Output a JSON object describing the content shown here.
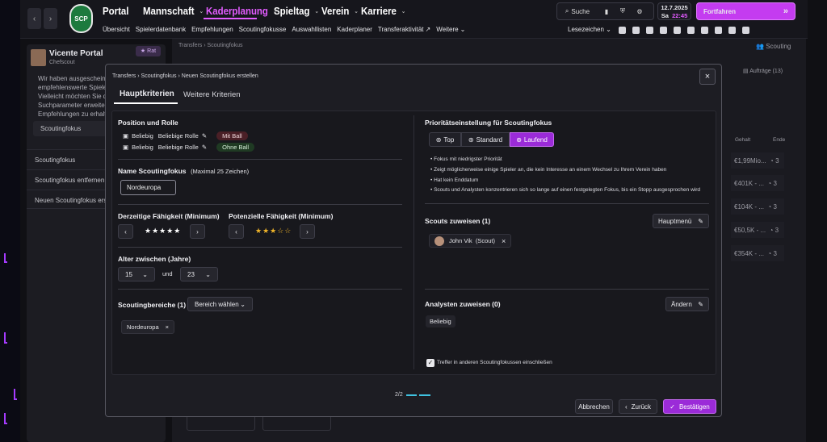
{
  "app": {
    "menu": [
      "Portal",
      "Mannschaft",
      "Kaderplanung",
      "Spieltag",
      "Verein",
      "Karriere"
    ],
    "subnav": [
      "Übersicht",
      "Spielerdatenbank",
      "Empfehlungen",
      "Scoutingfokusse",
      "Auswahllisten",
      "Kaderplaner",
      "Transferaktivität",
      "Weitere"
    ],
    "lesezeichen": "Lesezeichen",
    "search": "Suche",
    "date": "12.7.2025",
    "day": "Sa",
    "time": "22:45",
    "continue": "Fortfahren",
    "accent": "#d438ff"
  },
  "left": {
    "name": "Vicente Portal",
    "role": "Chefscout",
    "rat": "Rat",
    "msg": [
      "Wir haben ausgeschein",
      "empfehlenswerte Spiele",
      "Vielleicht möchten Sie di",
      "Suchparameter erweiter",
      "Empfehlungen zu erhalt"
    ],
    "field": "Scoutingfokus",
    "items": [
      "Scoutingfokus",
      "Scoutingfokus entfernen",
      "Neuen Scoutingfokus erst"
    ]
  },
  "bg": {
    "breadcrumb": [
      "Transfers",
      "Scoutingfokus"
    ],
    "scouting": "Scouting",
    "auftraege": "Aufträge (13)",
    "col_gehalt": "Gehalt",
    "col_ende": "Ende",
    "rows": [
      [
        "€1,99Mio...",
        "3"
      ],
      [
        "€401K - ...",
        "3"
      ],
      [
        "€104K - ...",
        "3"
      ],
      [
        "€50,5K - ...",
        "3"
      ],
      [
        "€354K - ...",
        "3"
      ]
    ]
  },
  "modal": {
    "breadcrumb": [
      "Transfers",
      "Scoutingfokus",
      "Neuen Scoutingfokus erstellen"
    ],
    "tabs": [
      "Hauptkriterien",
      "Weitere Kriterien"
    ],
    "position_title": "Position und Rolle",
    "positions": [
      {
        "pos": "Beliebig",
        "role": "Beliebige Rolle",
        "tag": "Mit Ball"
      },
      {
        "pos": "Beliebig",
        "role": "Beliebige Rolle",
        "tag": "Ohne Ball"
      }
    ],
    "name_title": "Name Scoutingfokus",
    "name_hint": "(Maximal 25 Zeichen)",
    "name_value": "Nordeuropa",
    "current_title": "Derzeitige Fähigkeit (Minimum)",
    "current_stars": 5,
    "potential_title": "Potenzielle Fähigkeit (Minimum)",
    "potential_stars": 3,
    "age_title": "Alter zwischen (Jahre)",
    "age_from": "15",
    "age_and": "und",
    "age_to": "23",
    "areas_title": "Scoutingbereiche (1)",
    "areas_select": "Bereich wählen",
    "area_tag": "Nordeuropa",
    "prio_title": "Prioritätseinstellung für Scoutingfokus",
    "prio_options": [
      "Top",
      "Standard",
      "Laufend"
    ],
    "prio_selected": "Laufend",
    "prio_bullets": [
      "Fokus mit niedrigster Priorität",
      "Zeigt möglicherweise einige Spieler an, die kein Interesse an einem Wechsel zu Ihrem Verein haben",
      "Hat kein Enddatum",
      "Scouts und Analysten konzentrieren sich so lange auf einen festgelegten Fokus, bis ein Stopp ausgesprochen wird"
    ],
    "scouts_title": "Scouts zuweisen (1)",
    "scouts_btn": "Hauptmenü",
    "scout_name": "John Vik",
    "scout_role": "(Scout)",
    "analysts_title": "Analysten zuweisen (0)",
    "analysts_btn": "Ändern",
    "analysts_value": "Beliebig",
    "checkbox_label": "Treffer in anderen Scoutingfokussen einschließen",
    "page": "2/2",
    "cancel": "Abbrechen",
    "back": "Zurück",
    "confirm": "Bestätigen"
  }
}
